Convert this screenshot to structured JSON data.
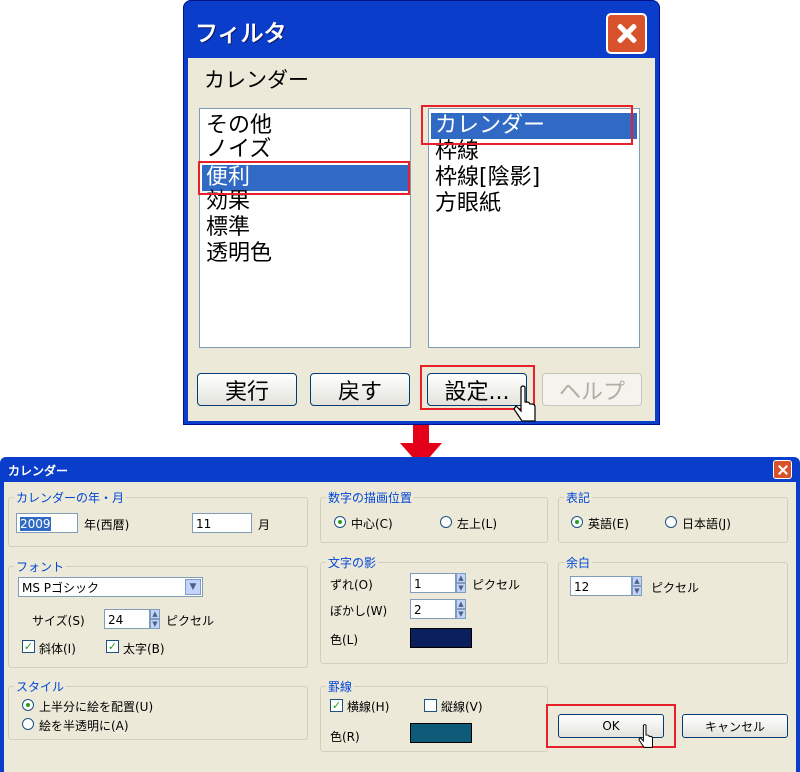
{
  "filter_dialog": {
    "title": "フィルタ",
    "current_category": "カレンダー",
    "categories": [
      "その他",
      "ノイズ",
      "便利",
      "効果",
      "標準",
      "透明色"
    ],
    "selected_category": "便利",
    "filters": [
      "カレンダー",
      "枠線",
      "枠線[陰影]",
      "方眼紙"
    ],
    "selected_filter": "カレンダー",
    "buttons": {
      "run": "実行",
      "undo": "戻す",
      "settings": "設定...",
      "help": "ヘルプ"
    }
  },
  "calendar_dialog": {
    "title": "カレンダー",
    "year_month": {
      "legend": "カレンダーの年・月",
      "year_value": "2009",
      "year_label": "年(西暦)",
      "month_value": "11",
      "month_label": "月"
    },
    "font": {
      "legend": "フォント",
      "font_name": "MS Pゴシック",
      "size_label": "サイズ(S)",
      "size_value": "24",
      "size_unit": "ピクセル",
      "italic_label": "斜体(I)",
      "italic_checked": true,
      "bold_label": "太字(B)",
      "bold_checked": true
    },
    "style": {
      "legend": "スタイル",
      "option_top": "上半分に絵を配置(U)",
      "option_transparent": "絵を半透明に(A)",
      "selected": "option_top"
    },
    "number_position": {
      "legend": "数字の描画位置",
      "center": "中心(C)",
      "top_left": "左上(L)",
      "selected": "center"
    },
    "text_shadow": {
      "legend": "文字の影",
      "offset_label": "ずれ(O)",
      "offset_value": "1",
      "offset_unit": "ピクセル",
      "blur_label": "ぼかし(W)",
      "blur_value": "2",
      "color_label": "色(L)",
      "color": "#0b1f5c"
    },
    "ruled_lines": {
      "legend": "罫線",
      "horizontal_label": "横線(H)",
      "horizontal_checked": true,
      "vertical_label": "縦線(V)",
      "vertical_checked": false,
      "color_label": "色(R)",
      "color": "#0f5a78"
    },
    "notation": {
      "legend": "表記",
      "english": "英語(E)",
      "japanese": "日本語(J)",
      "selected": "english"
    },
    "margin": {
      "legend": "余白",
      "value": "12",
      "unit": "ピクセル"
    },
    "buttons": {
      "ok": "OK",
      "cancel": "キャンセル"
    }
  },
  "colors": {
    "highlight": "#e8202a",
    "selection": "#316ac5",
    "arrow": "#e5001a",
    "xp_blue": "#0a3dca"
  }
}
